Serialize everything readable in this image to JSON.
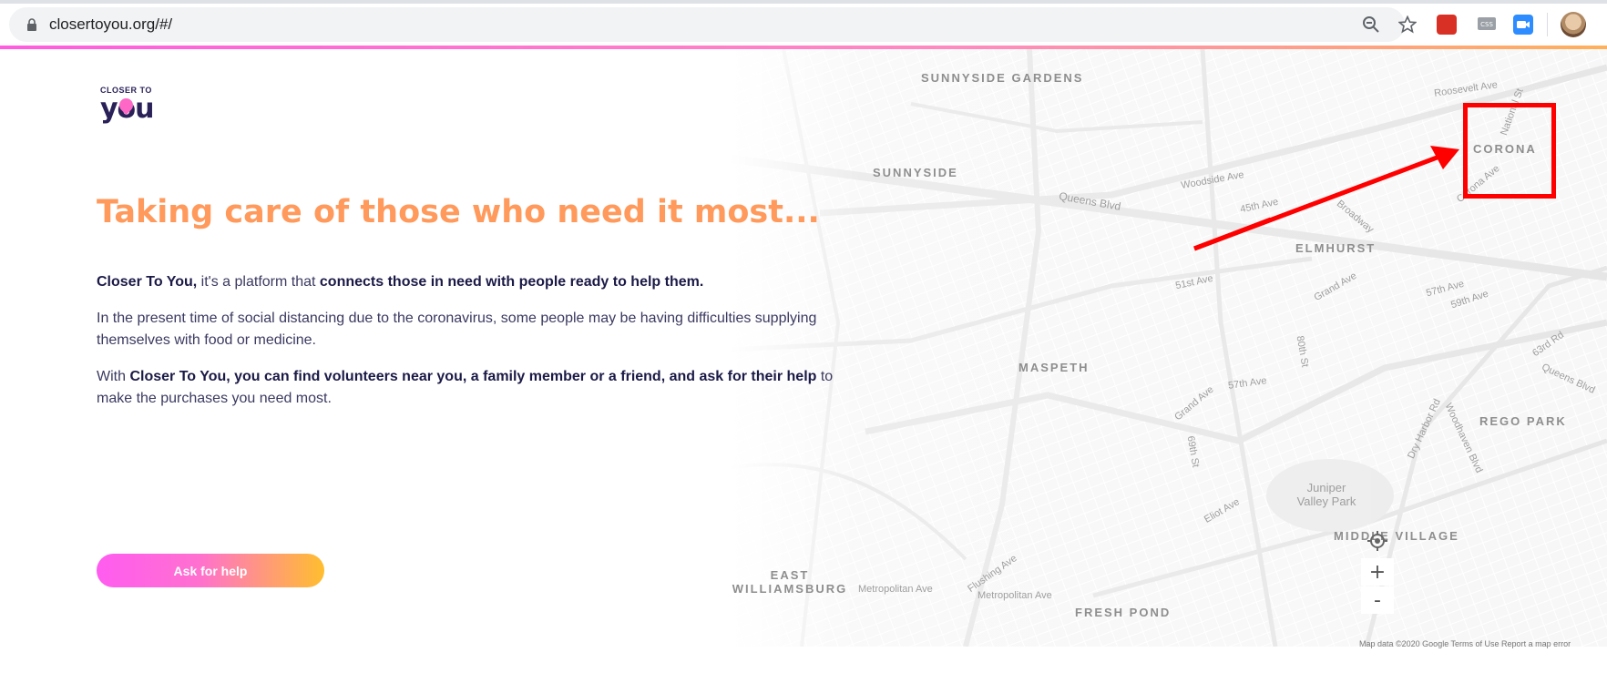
{
  "browser": {
    "url": "closertoyou.org/#/"
  },
  "logo": {
    "top_text": "CLOSER TO",
    "word": "you"
  },
  "headline": "Taking care of those who need it most...",
  "paragraph1": {
    "brand": "Closer To You,",
    "middle": " it's a platform that ",
    "emphasis": "connects those in need with people ready to help them."
  },
  "paragraph2": "In the present time of social distancing due to the coronavirus, some people may be having difficulties supplying themselves with food or medicine.",
  "paragraph3": {
    "start": "With ",
    "emphasis": "Closer To You, you can find volunteers near you, a family member or a friend, and ask for their help",
    "end": " to make the purchases you need most."
  },
  "cta_label": "Ask for help",
  "map": {
    "neighborhoods": [
      "SUNNYSIDE GARDENS",
      "SUNNYSIDE",
      "CORONA",
      "ELMHURST",
      "MASPETH",
      "REGO PARK",
      "MIDDLE VILLAGE",
      "EAST WILLIAMSBURG",
      "FRESH POND"
    ],
    "streets": [
      "Roosevelt Ave",
      "Queens Blvd",
      "Woodside Ave",
      "45th Ave",
      "Broadway",
      "51st Ave",
      "Grand Ave",
      "57th Ave",
      "59th Ave",
      "63rd Rd",
      "Queens Blvd",
      "57th Ave",
      "Juniper Valley Park",
      "Eliot Ave",
      "Metropolitan Ave",
      "Flushing Ave",
      "Metropolitan Ave",
      "Woodhaven Blvd",
      "Dry Harbor Rd",
      "69th St",
      "80th St",
      "Grand Ave",
      "National St",
      "Corona Ave"
    ],
    "zoom_in": "+",
    "zoom_out": "-",
    "attribution": "Map data ©2020 Google   Terms of Use   Report a map error"
  },
  "colors": {
    "headline": "#ff9a5c",
    "annotation": "#ff0000",
    "text": "#3b3a61"
  }
}
